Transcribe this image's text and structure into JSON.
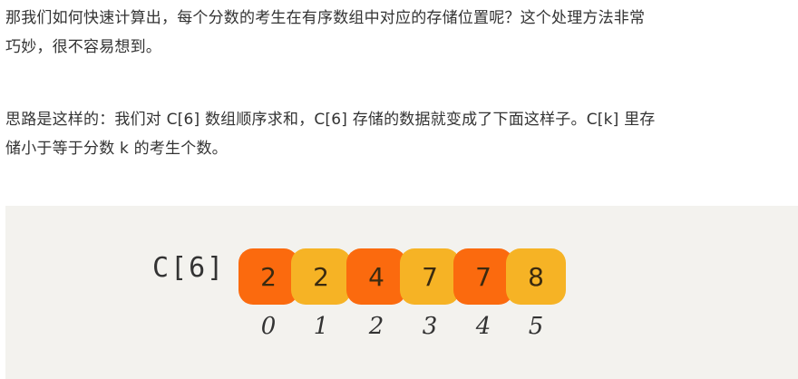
{
  "paragraphs": {
    "p1": [
      "那我们如何快速计算出，每个分数的考生在有序数组中对应的存储位置呢？这个处理方法非常",
      "巧妙，很不容易想到。"
    ],
    "p2": [
      "思路是这样的：我们对 C[6] 数组顺序求和，C[6] 存储的数据就变成了下面这样子。C[k] 里存",
      "储小于等于分数 k 的考生个数。"
    ]
  },
  "figure": {
    "array_label": "C[6]",
    "cells": [
      {
        "value": "2",
        "index": "0",
        "color": "#fb6a0e"
      },
      {
        "value": "2",
        "index": "1",
        "color": "#f6b325"
      },
      {
        "value": "4",
        "index": "2",
        "color": "#fb6a0e"
      },
      {
        "value": "7",
        "index": "3",
        "color": "#f6b325"
      },
      {
        "value": "7",
        "index": "4",
        "color": "#fb6a0e"
      },
      {
        "value": "8",
        "index": "5",
        "color": "#f6b325"
      }
    ]
  }
}
